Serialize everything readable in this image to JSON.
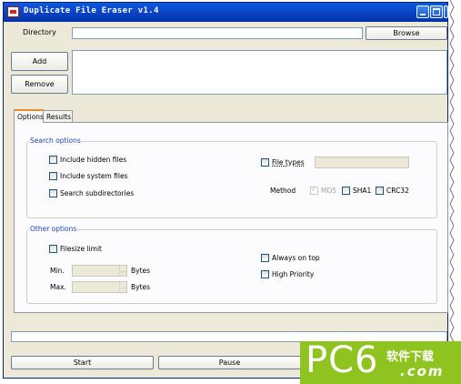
{
  "window": {
    "title": "Duplicate File Eraser v1.4",
    "colors": {
      "titlebar": "#0a3fbf",
      "face": "#ece9d8",
      "group_label": "#1e45b4",
      "active_tab_accent": "#e68b2c"
    }
  },
  "directory": {
    "label": "Directory",
    "value": "",
    "browse_label": "Browse"
  },
  "actions": {
    "add_label": "Add",
    "remove_label": "Remove"
  },
  "tabs": [
    {
      "label": "Options",
      "active": true
    },
    {
      "label": "Results",
      "active": false
    }
  ],
  "search_options": {
    "legend": "Search options",
    "include_hidden": {
      "label": "Include hidden files",
      "checked": false
    },
    "include_system": {
      "label": "Include system files",
      "checked": false
    },
    "search_subdirs": {
      "label": "Search subdirectories",
      "checked": false
    },
    "file_types": {
      "label": "File types",
      "checked": false,
      "value": ""
    },
    "method": {
      "label": "Method",
      "md5": {
        "label": "MD5",
        "checked": true,
        "enabled": false
      },
      "sha1": {
        "label": "SHA1",
        "checked": false
      },
      "crc32": {
        "label": "CRC32",
        "checked": false
      }
    }
  },
  "other_options": {
    "legend": "Other options",
    "filesize_limit": {
      "label": "Filesize limit",
      "checked": false
    },
    "min": {
      "label": "Min.",
      "value": "",
      "unit": "Bytes"
    },
    "max": {
      "label": "Max.",
      "value": "",
      "unit": "Bytes"
    },
    "always_on_top": {
      "label": "Always on top",
      "checked": false
    },
    "high_priority": {
      "label": "High Priority",
      "checked": false
    }
  },
  "status_bar": {
    "text": ""
  },
  "bottom_buttons": {
    "start_label": "Start",
    "pause_label": "Pause"
  },
  "watermark": {
    "text": "PC6",
    "cn_text": "软件下载",
    "domain": ".com",
    "color": "#8fc31f"
  }
}
